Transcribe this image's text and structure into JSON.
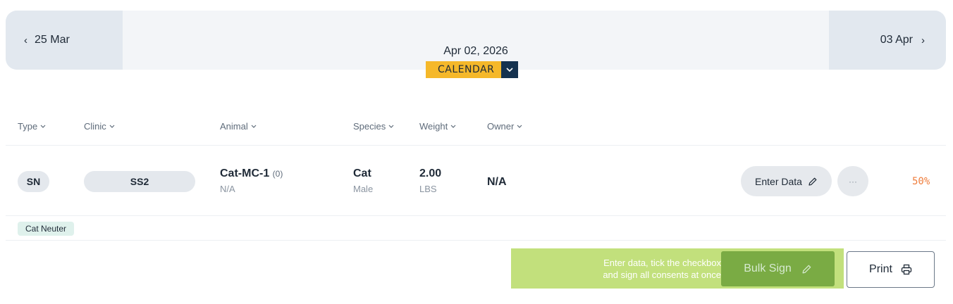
{
  "nav": {
    "prev_label": "25 Mar",
    "current_date": "Apr 02, 2026",
    "next_label": "03 Apr",
    "view_label": "CALENDAR"
  },
  "columns": [
    {
      "label": "Type"
    },
    {
      "label": "Clinic"
    },
    {
      "label": "Animal"
    },
    {
      "label": "Species"
    },
    {
      "label": "Weight"
    },
    {
      "label": "Owner"
    }
  ],
  "row": {
    "type": "SN",
    "clinic": "SS2",
    "animal_name": "Cat-MC-1",
    "animal_count": "(0)",
    "animal_sub": "N/A",
    "species": "Cat",
    "sex": "Male",
    "weight": "2.00",
    "weight_unit": "LBS",
    "owner": "N/A",
    "enter_data_label": "Enter Data",
    "more_label": "···",
    "progress": "50%",
    "tag": "Cat Neuter"
  },
  "footer": {
    "hint_line1": "Enter data, tick the checkbox",
    "hint_line2": "and sign all consents at once",
    "bulk_sign_label": "Bulk Sign",
    "print_label": "Print"
  },
  "colors": {
    "accent_yellow": "#f5b82a",
    "navy": "#15324f",
    "highlight_green": "#c2e07c",
    "button_green": "#7aab44",
    "progress_orange": "#ef7d3c",
    "tag_bg": "#dff1ec"
  }
}
